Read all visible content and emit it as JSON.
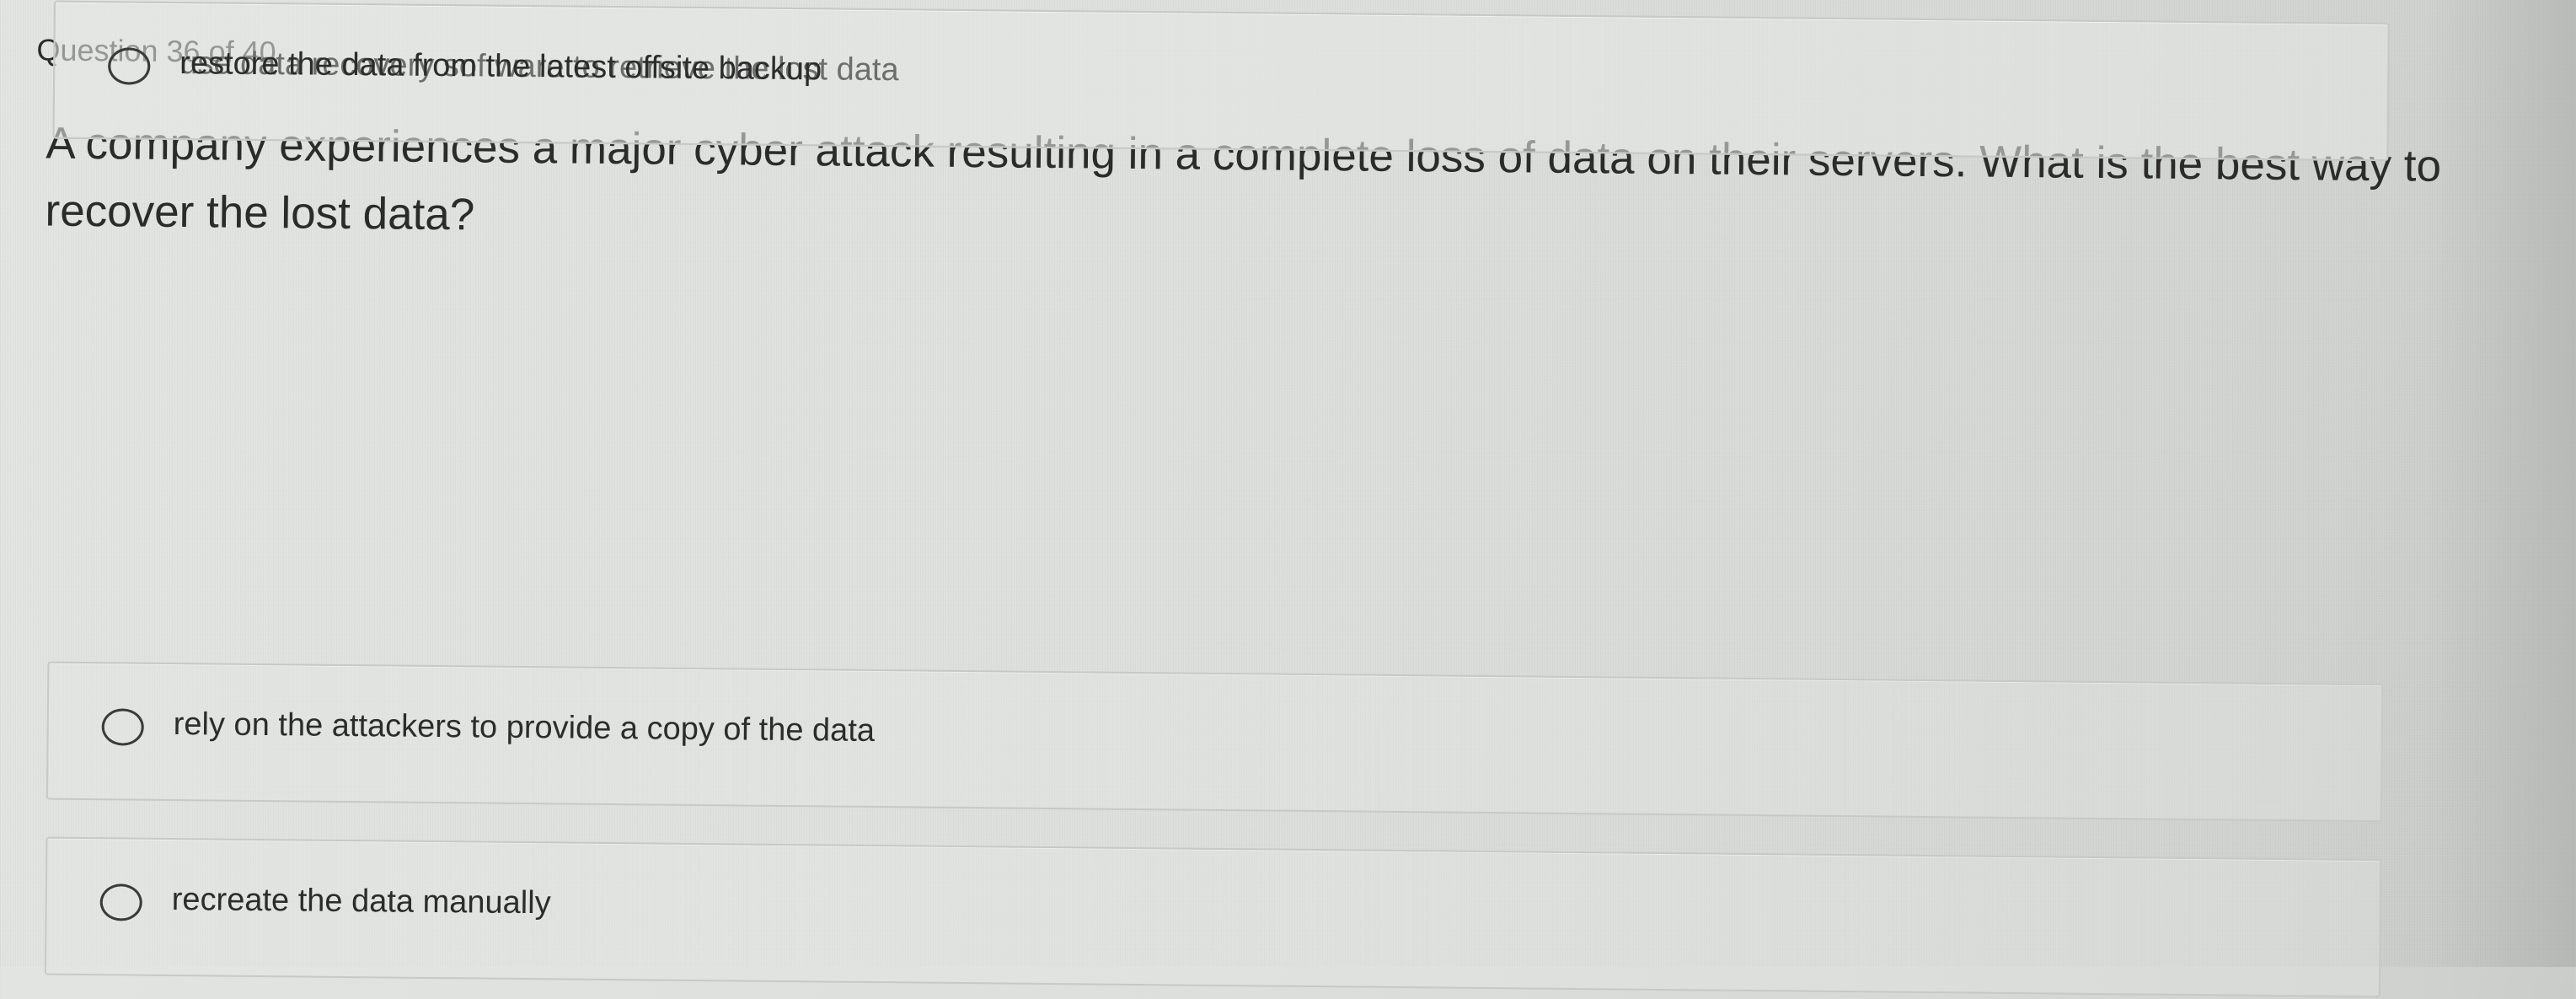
{
  "quiz": {
    "counter": "Question 36 of 40",
    "question": "A company experiences a major cyber attack resulting in a complete loss of data on their servers. What is the best way to recover the lost data?",
    "options": [
      {
        "label": "rely on the attackers to provide a copy of the data"
      },
      {
        "label": "recreate the data manually"
      },
      {
        "label": "use data recovery software to retrieve the lost data"
      },
      {
        "label": "restore the data from the latest offsite backup"
      }
    ]
  }
}
